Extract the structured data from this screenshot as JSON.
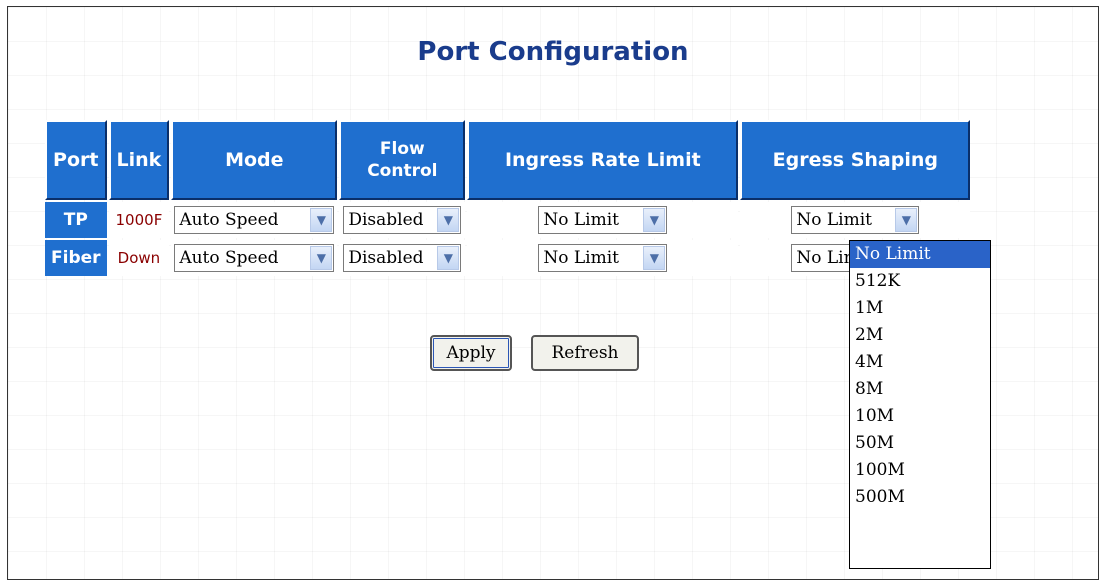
{
  "page": {
    "title": "Port Configuration"
  },
  "table": {
    "headers": {
      "port": "Port",
      "link": "Link",
      "mode": "Mode",
      "flow_line1": "Flow",
      "flow_line2": "Control",
      "ingress": "Ingress Rate Limit",
      "egress": "Egress Shaping"
    },
    "rows": [
      {
        "port": "TP",
        "link": "1000F",
        "link_status": "up",
        "mode": "Auto Speed",
        "flow_control": "Disabled",
        "ingress": "No Limit",
        "egress": "No Limit"
      },
      {
        "port": "Fiber",
        "link": "Down",
        "link_status": "down",
        "mode": "Auto Speed",
        "flow_control": "Disabled",
        "ingress": "No Limit",
        "egress": "No Limit"
      }
    ]
  },
  "buttons": {
    "apply": "Apply",
    "refresh": "Refresh"
  },
  "egress_dropdown": {
    "selected": "No Limit",
    "options": [
      "No Limit",
      "512K",
      "1M",
      "2M",
      "4M",
      "8M",
      "10M",
      "50M",
      "100M",
      "500M"
    ]
  },
  "icons": {
    "select_arrow": "chevron-down-icon"
  },
  "colors": {
    "header_bg": "#1f6fcf",
    "title": "#1a3c8c",
    "link_up": "#22c02a",
    "link_down": "#ee3a10",
    "selected_option": "#2a63c8"
  }
}
